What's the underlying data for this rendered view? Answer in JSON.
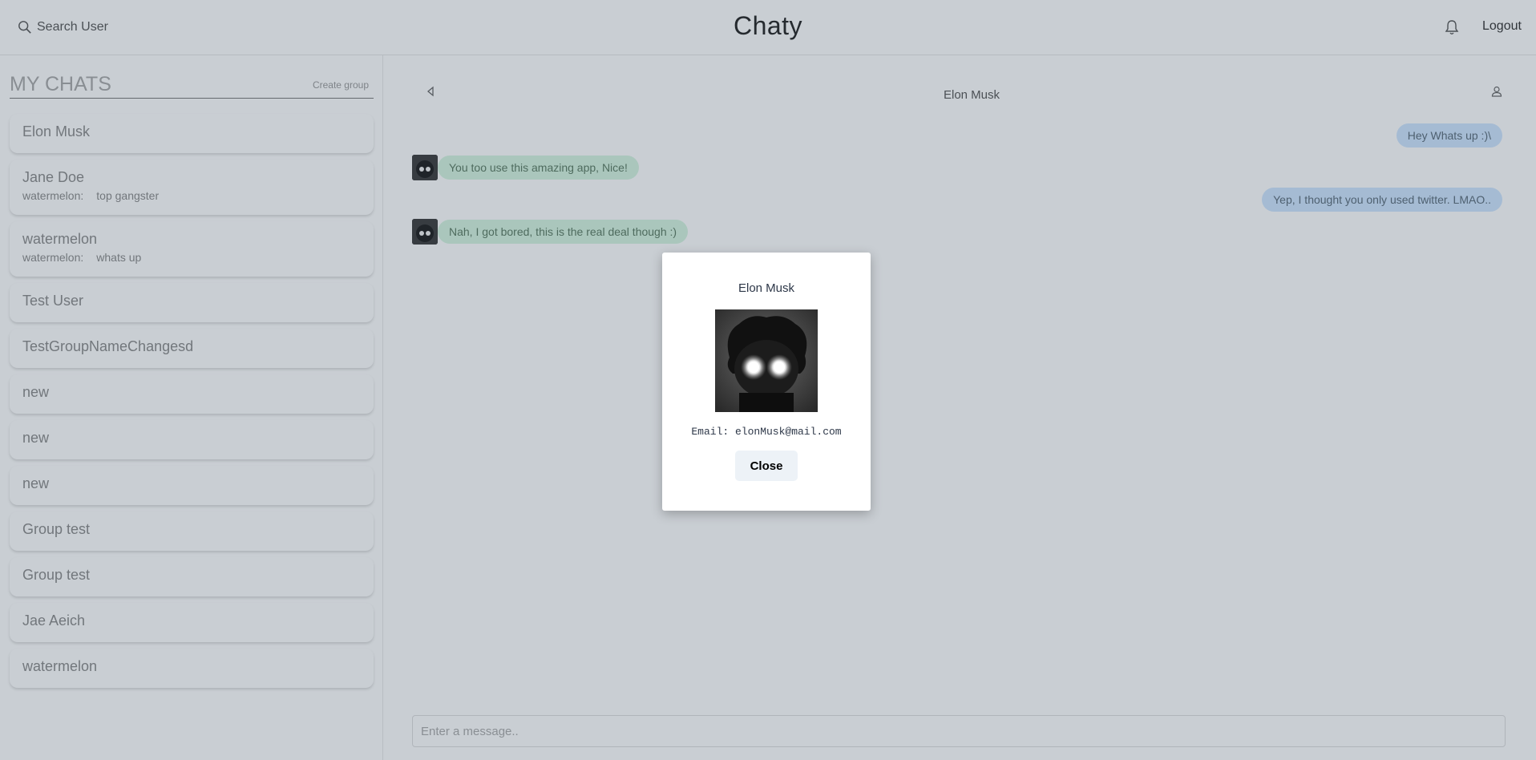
{
  "header": {
    "search_label": "Search User",
    "app_title": "Chaty",
    "logout_label": "Logout"
  },
  "sidebar": {
    "title": "MY CHATS",
    "create_group_label": "Create group",
    "chats": [
      {
        "name": "Elon Musk"
      },
      {
        "name": "Jane Doe",
        "preview_sender": "watermelon:",
        "preview_text": "top gangster"
      },
      {
        "name": "watermelon",
        "preview_sender": "watermelon:",
        "preview_text": "whats up"
      },
      {
        "name": "Test User"
      },
      {
        "name": "TestGroupNameChangesd"
      },
      {
        "name": "new"
      },
      {
        "name": "new"
      },
      {
        "name": "new"
      },
      {
        "name": "Group test"
      },
      {
        "name": "Group test"
      },
      {
        "name": "Jae Aeich"
      },
      {
        "name": "watermelon"
      }
    ]
  },
  "chat": {
    "title": "Elon Musk",
    "messages": [
      {
        "from": "me",
        "text": "Hey Whats up :)\\"
      },
      {
        "from": "them",
        "text": "You too use this amazing app, Nice!"
      },
      {
        "from": "me",
        "text": "Yep, I thought you only used twitter. LMAO.."
      },
      {
        "from": "them",
        "text": "Nah, I got bored, this is the real deal though :)"
      }
    ],
    "input_placeholder": "Enter a message.."
  },
  "modal": {
    "name": "Elon Musk",
    "email_text": "Email: elonMusk@mail.com",
    "close_label": "Close"
  },
  "icons": {
    "search": "search-icon",
    "bell": "bell-icon",
    "back": "back-arrow-icon",
    "profile": "user-icon"
  },
  "colors": {
    "overlay": "#2f4255",
    "my_bubble": "#cfe6ff",
    "their_bubble": "#d6f5e0"
  }
}
